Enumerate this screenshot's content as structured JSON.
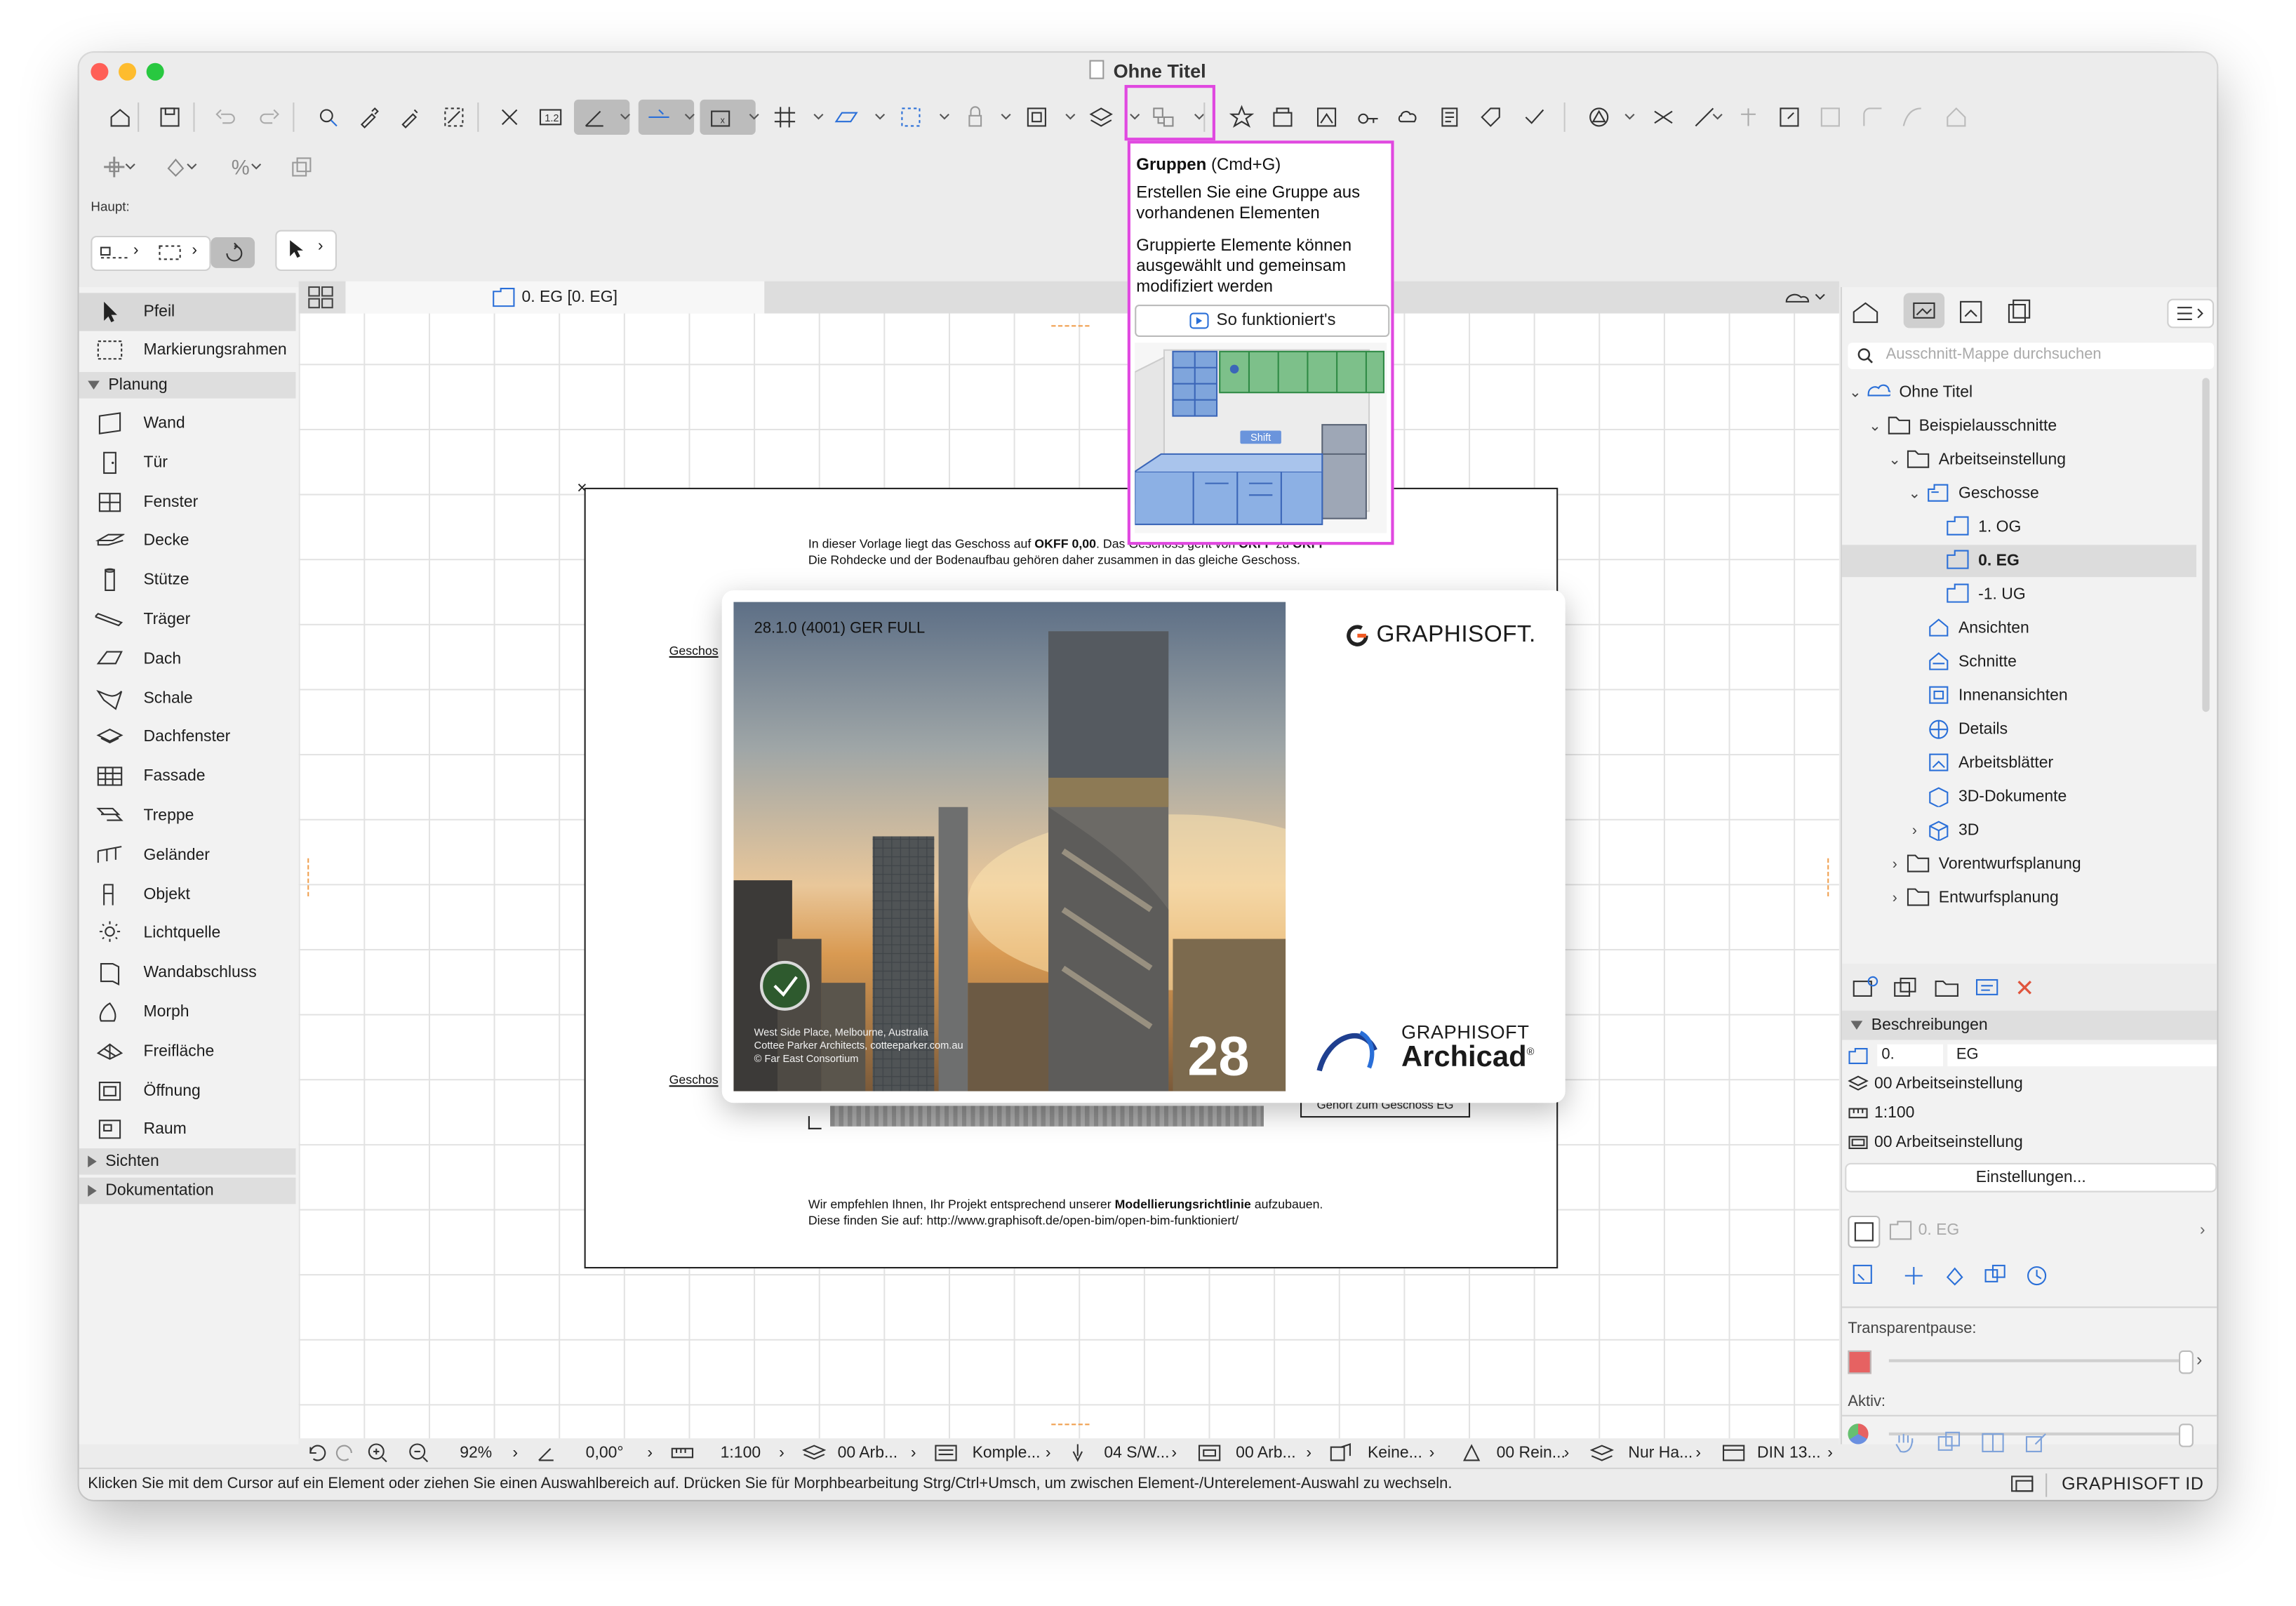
{
  "window": {
    "title": "Ohne Titel"
  },
  "toolbar": {
    "main_label": "Haupt:"
  },
  "tooltip": {
    "title": "Gruppen",
    "shortcut": "(Cmd+G)",
    "line1": "Erstellen Sie eine Gruppe aus vorhandenen Elementen",
    "line2": "Gruppierte Elemente können ausgewählt und gemeinsam modifiziert werden",
    "how_button": "So funktioniert's",
    "shift_label": "Shift"
  },
  "palette": {
    "items_top": [
      {
        "label": "Pfeil",
        "icon": "arrow-icon"
      },
      {
        "label": "Markierungsrahmen",
        "icon": "marquee-icon"
      }
    ],
    "section_planung": "Planung",
    "items": [
      {
        "label": "Wand",
        "icon": "wall-icon"
      },
      {
        "label": "Tür",
        "icon": "door-icon"
      },
      {
        "label": "Fenster",
        "icon": "window-icon"
      },
      {
        "label": "Decke",
        "icon": "slab-icon"
      },
      {
        "label": "Stütze",
        "icon": "column-icon"
      },
      {
        "label": "Träger",
        "icon": "beam-icon"
      },
      {
        "label": "Dach",
        "icon": "roof-icon"
      },
      {
        "label": "Schale",
        "icon": "shell-icon"
      },
      {
        "label": "Dachfenster",
        "icon": "skylight-icon"
      },
      {
        "label": "Fassade",
        "icon": "curtain-wall-icon"
      },
      {
        "label": "Treppe",
        "icon": "stair-icon"
      },
      {
        "label": "Geländer",
        "icon": "railing-icon"
      },
      {
        "label": "Objekt",
        "icon": "object-icon"
      },
      {
        "label": "Lichtquelle",
        "icon": "lamp-icon"
      },
      {
        "label": "Wandabschluss",
        "icon": "wall-end-icon"
      },
      {
        "label": "Morph",
        "icon": "morph-icon"
      },
      {
        "label": "Freifläche",
        "icon": "mesh-icon"
      },
      {
        "label": "Öffnung",
        "icon": "opening-icon"
      },
      {
        "label": "Raum",
        "icon": "zone-icon"
      }
    ],
    "section_sichten": "Sichten",
    "section_doku": "Dokumentation"
  },
  "canvas": {
    "tab_label": "0. EG [0. EG]",
    "sheet_line1_a": "In dieser Vorlage liegt das Geschoss auf ",
    "sheet_line1_b": "OKFF 0,00",
    "sheet_line1_c": ". Das Geschoss geht von ",
    "sheet_line1_d": "OKFF",
    "sheet_line1_e": " zu ",
    "sheet_line1_f": "OKFF",
    "sheet_line2": "Die Rohdecke und der Bodenaufbau gehören daher zusammen in das gleiche Geschoss.",
    "geschoss_label": "Geschos",
    "gehoert_label": "Gehört zum Geschoss EG",
    "sheet_line3_a": "Wir empfehlen Ihnen, Ihr Projekt entsprechend unserer ",
    "sheet_line3_b": "Modellierungsrichtlinie",
    "sheet_line3_c": " aufzubauen.",
    "sheet_line4": "Diese finden Sie auf:  http://www.graphisoft.de/open-bim/open-bim-funktioniert/"
  },
  "splash": {
    "version": "28.1.0 (4001) GER FULL",
    "brand": "GRAPHISOFT.",
    "caption1": "West Side Place, Melbourne, Australia",
    "caption2": "Cottee Parker Architects, cotteeparker.com.au",
    "caption3": "© Far East Consortium",
    "number": "28",
    "product_brand": "GRAPHISOFT",
    "product": "Archicad"
  },
  "navigator": {
    "search_placeholder": "Ausschnitt-Mappe durchsuchen",
    "tree": [
      {
        "label": "Ohne Titel",
        "level": 0,
        "chev": "v",
        "icon": "project-icon"
      },
      {
        "label": "Beispielausschnitte",
        "level": 1,
        "chev": "v",
        "icon": "folder-icon"
      },
      {
        "label": "Arbeitseinstellung",
        "level": 2,
        "chev": "v",
        "icon": "folder-icon"
      },
      {
        "label": "Geschosse",
        "level": 3,
        "chev": "v",
        "icon": "stories-icon"
      },
      {
        "label": "1. OG",
        "level": 4,
        "chev": "",
        "icon": "story-icon"
      },
      {
        "label": "0. EG",
        "level": 4,
        "chev": "",
        "icon": "story-icon",
        "selected": true
      },
      {
        "label": "-1. UG",
        "level": 4,
        "chev": "",
        "icon": "story-icon"
      },
      {
        "label": "Ansichten",
        "level": 3,
        "chev": "",
        "icon": "elevation-icon"
      },
      {
        "label": "Schnitte",
        "level": 3,
        "chev": "",
        "icon": "section-icon"
      },
      {
        "label": "Innenansichten",
        "level": 3,
        "chev": "",
        "icon": "interior-icon"
      },
      {
        "label": "Details",
        "level": 3,
        "chev": "",
        "icon": "detail-icon"
      },
      {
        "label": "Arbeitsblätter",
        "level": 3,
        "chev": "",
        "icon": "worksheet-icon"
      },
      {
        "label": "3D-Dokumente",
        "level": 3,
        "chev": "",
        "icon": "3d-doc-icon"
      },
      {
        "label": "3D",
        "level": 3,
        "chev": ">",
        "icon": "3d-icon"
      },
      {
        "label": "Vorentwurfsplanung",
        "level": 2,
        "chev": ">",
        "icon": "folder-icon"
      },
      {
        "label": "Entwurfsplanung",
        "level": 2,
        "chev": ">",
        "icon": "folder-icon"
      }
    ],
    "section_beschreibungen": "Beschreibungen",
    "id_value": "0.",
    "name_value": "EG",
    "layer_value": "00 Arbeitseinstellung",
    "scale_value": "1:100",
    "model_value": "00 Arbeitseinstellung",
    "settings_button": "Einstellungen...",
    "story_field": "0. EG",
    "transparent_label": "Transparentpause:",
    "active_label": "Aktiv:"
  },
  "statusbar": {
    "zoom": "92%",
    "angle": "0,00°",
    "scale": "1:100",
    "layer": "00 Arb...",
    "penset": "Komple...",
    "pen": "04 S/W...",
    "model": "00 Arb...",
    "renovation": "Keine...",
    "reno_filter": "00 Rein...",
    "structure": "Nur Ha...",
    "dimension": "DIN 13..."
  },
  "message": {
    "text": "Klicken Sie mit dem Cursor auf ein Element oder ziehen Sie einen Auswahlbereich auf. Drücken Sie für Morphbearbeitung Strg/Ctrl+Umsch, um zwischen Element-/Unterelement-Auswahl zu wechseln.",
    "brand_id": "GRAPHISOFT ID"
  },
  "colors": {
    "highlight": "#e048e0",
    "selection": "#dcdcdc",
    "splash_number": "#ffffff",
    "brand_orange": "#f15a22",
    "archicad_blue": "#1f3f8f"
  }
}
